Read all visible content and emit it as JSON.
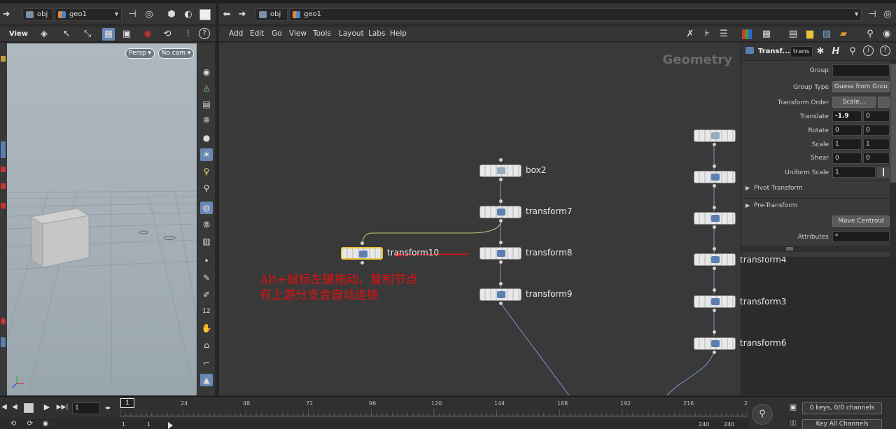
{
  "left_pane": {
    "path": {
      "obj": "obj",
      "geo": "geo1"
    },
    "toolbar": {
      "view_label": "View"
    },
    "viewport": {
      "persp_label": "Persp ▾",
      "cam_label": "No cam ▾"
    }
  },
  "network_pane": {
    "path": {
      "obj": "obj",
      "geo": "geo1"
    },
    "menu": [
      "Add",
      "Edit",
      "Go",
      "View",
      "Tools",
      "Layout",
      "Labs",
      "Help"
    ],
    "context_label": "Geometry",
    "nodes": {
      "box2": "box2",
      "transform7": "transform7",
      "transform8": "transform8",
      "transform9": "transform9",
      "transform10": "transform10",
      "transform4": "transform4",
      "transform3": "transform3",
      "transform6": "transform6"
    },
    "annotation": {
      "line1": "Alt+鼠标左键拖动，复制节点",
      "line2": "有上游分支会自动连接"
    },
    "annotation_color": "#e01010"
  },
  "parameters": {
    "node_type": "Transf...",
    "node_name": "trans",
    "rows": {
      "group": {
        "label": "Group",
        "value": ""
      },
      "group_type": {
        "label": "Group Type",
        "value": "Guess from Grou"
      },
      "transform_order": {
        "label": "Transform Order",
        "value": "Scale..."
      },
      "translate": {
        "label": "Translate",
        "x": "-1.9",
        "y": "0"
      },
      "rotate": {
        "label": "Rotate",
        "x": "0",
        "y": "0"
      },
      "scale": {
        "label": "Scale",
        "x": "1",
        "y": "1"
      },
      "shear": {
        "label": "Shear",
        "x": "0",
        "y": "0"
      },
      "uniform_scale": {
        "label": "Uniform Scale",
        "value": "1"
      },
      "pivot_transform": "Pivot Transform",
      "pre_transform": "Pre-Transform",
      "move_centroid": "Move Centroid",
      "attributes": {
        "label": "Attributes",
        "value": "*"
      }
    }
  },
  "timeline": {
    "current_frame": "1",
    "frame_marker": "1",
    "ticks": [
      "24",
      "48",
      "72",
      "96",
      "120",
      "144",
      "168",
      "192",
      "216",
      "2"
    ],
    "start_frame": "1",
    "start_frame2": "1",
    "end_frame": "240",
    "end_frame2": "240",
    "keys_label": "0 keys, 0/0 channels",
    "key_all_label": "Key All Channels"
  }
}
